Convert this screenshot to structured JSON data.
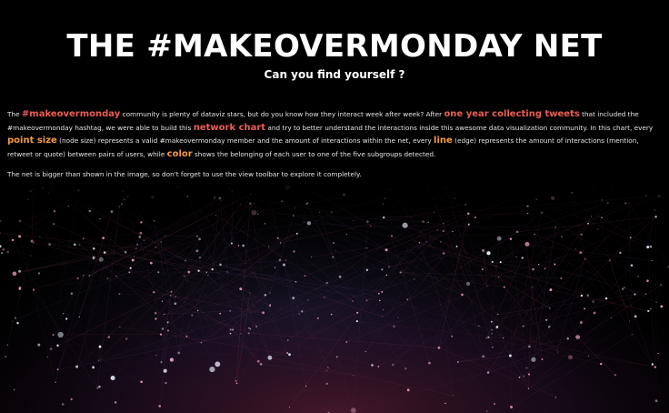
{
  "header": {
    "title": "THE #MAKEOVERMONDAY NET",
    "subtitle": "Can you find yourself ?"
  },
  "intro": {
    "t1": "The ",
    "h1": "#makeovermonday",
    "t2": " community is plenty of dataviz stars, but do you know how they interact week after week?  After ",
    "h2": "one year collecting tweets",
    "t3": " that included the #makeovermonday hashtag, we were able to build this ",
    "h3": "network chart",
    "t4": " and try to better understand the interactions inside this awesome data visualization community. In this chart, every ",
    "h4": "point size",
    "t5": " (node size) represents a valid #makeovermonday member and the amount of interactions within the net, every ",
    "h5": "line",
    "t6": " (edge) represents the amount of interactions (mention, retweet or quote) between pairs of users, while ",
    "h6": "color",
    "t7": " shows the belonging of each user to one of the five subgroups detected."
  },
  "note": "The net is bigger than shown in the image, so don't forget to use the view toolbar to explore it completely.",
  "colors": {
    "background": "#000000",
    "highlight_red": "#ee5d52",
    "highlight_orange": "#f39a3c",
    "node_pink": "#f2a3c8",
    "node_white": "#eef3ff",
    "edge_violet": "#6b4a8a",
    "edge_red": "#c0505f"
  }
}
